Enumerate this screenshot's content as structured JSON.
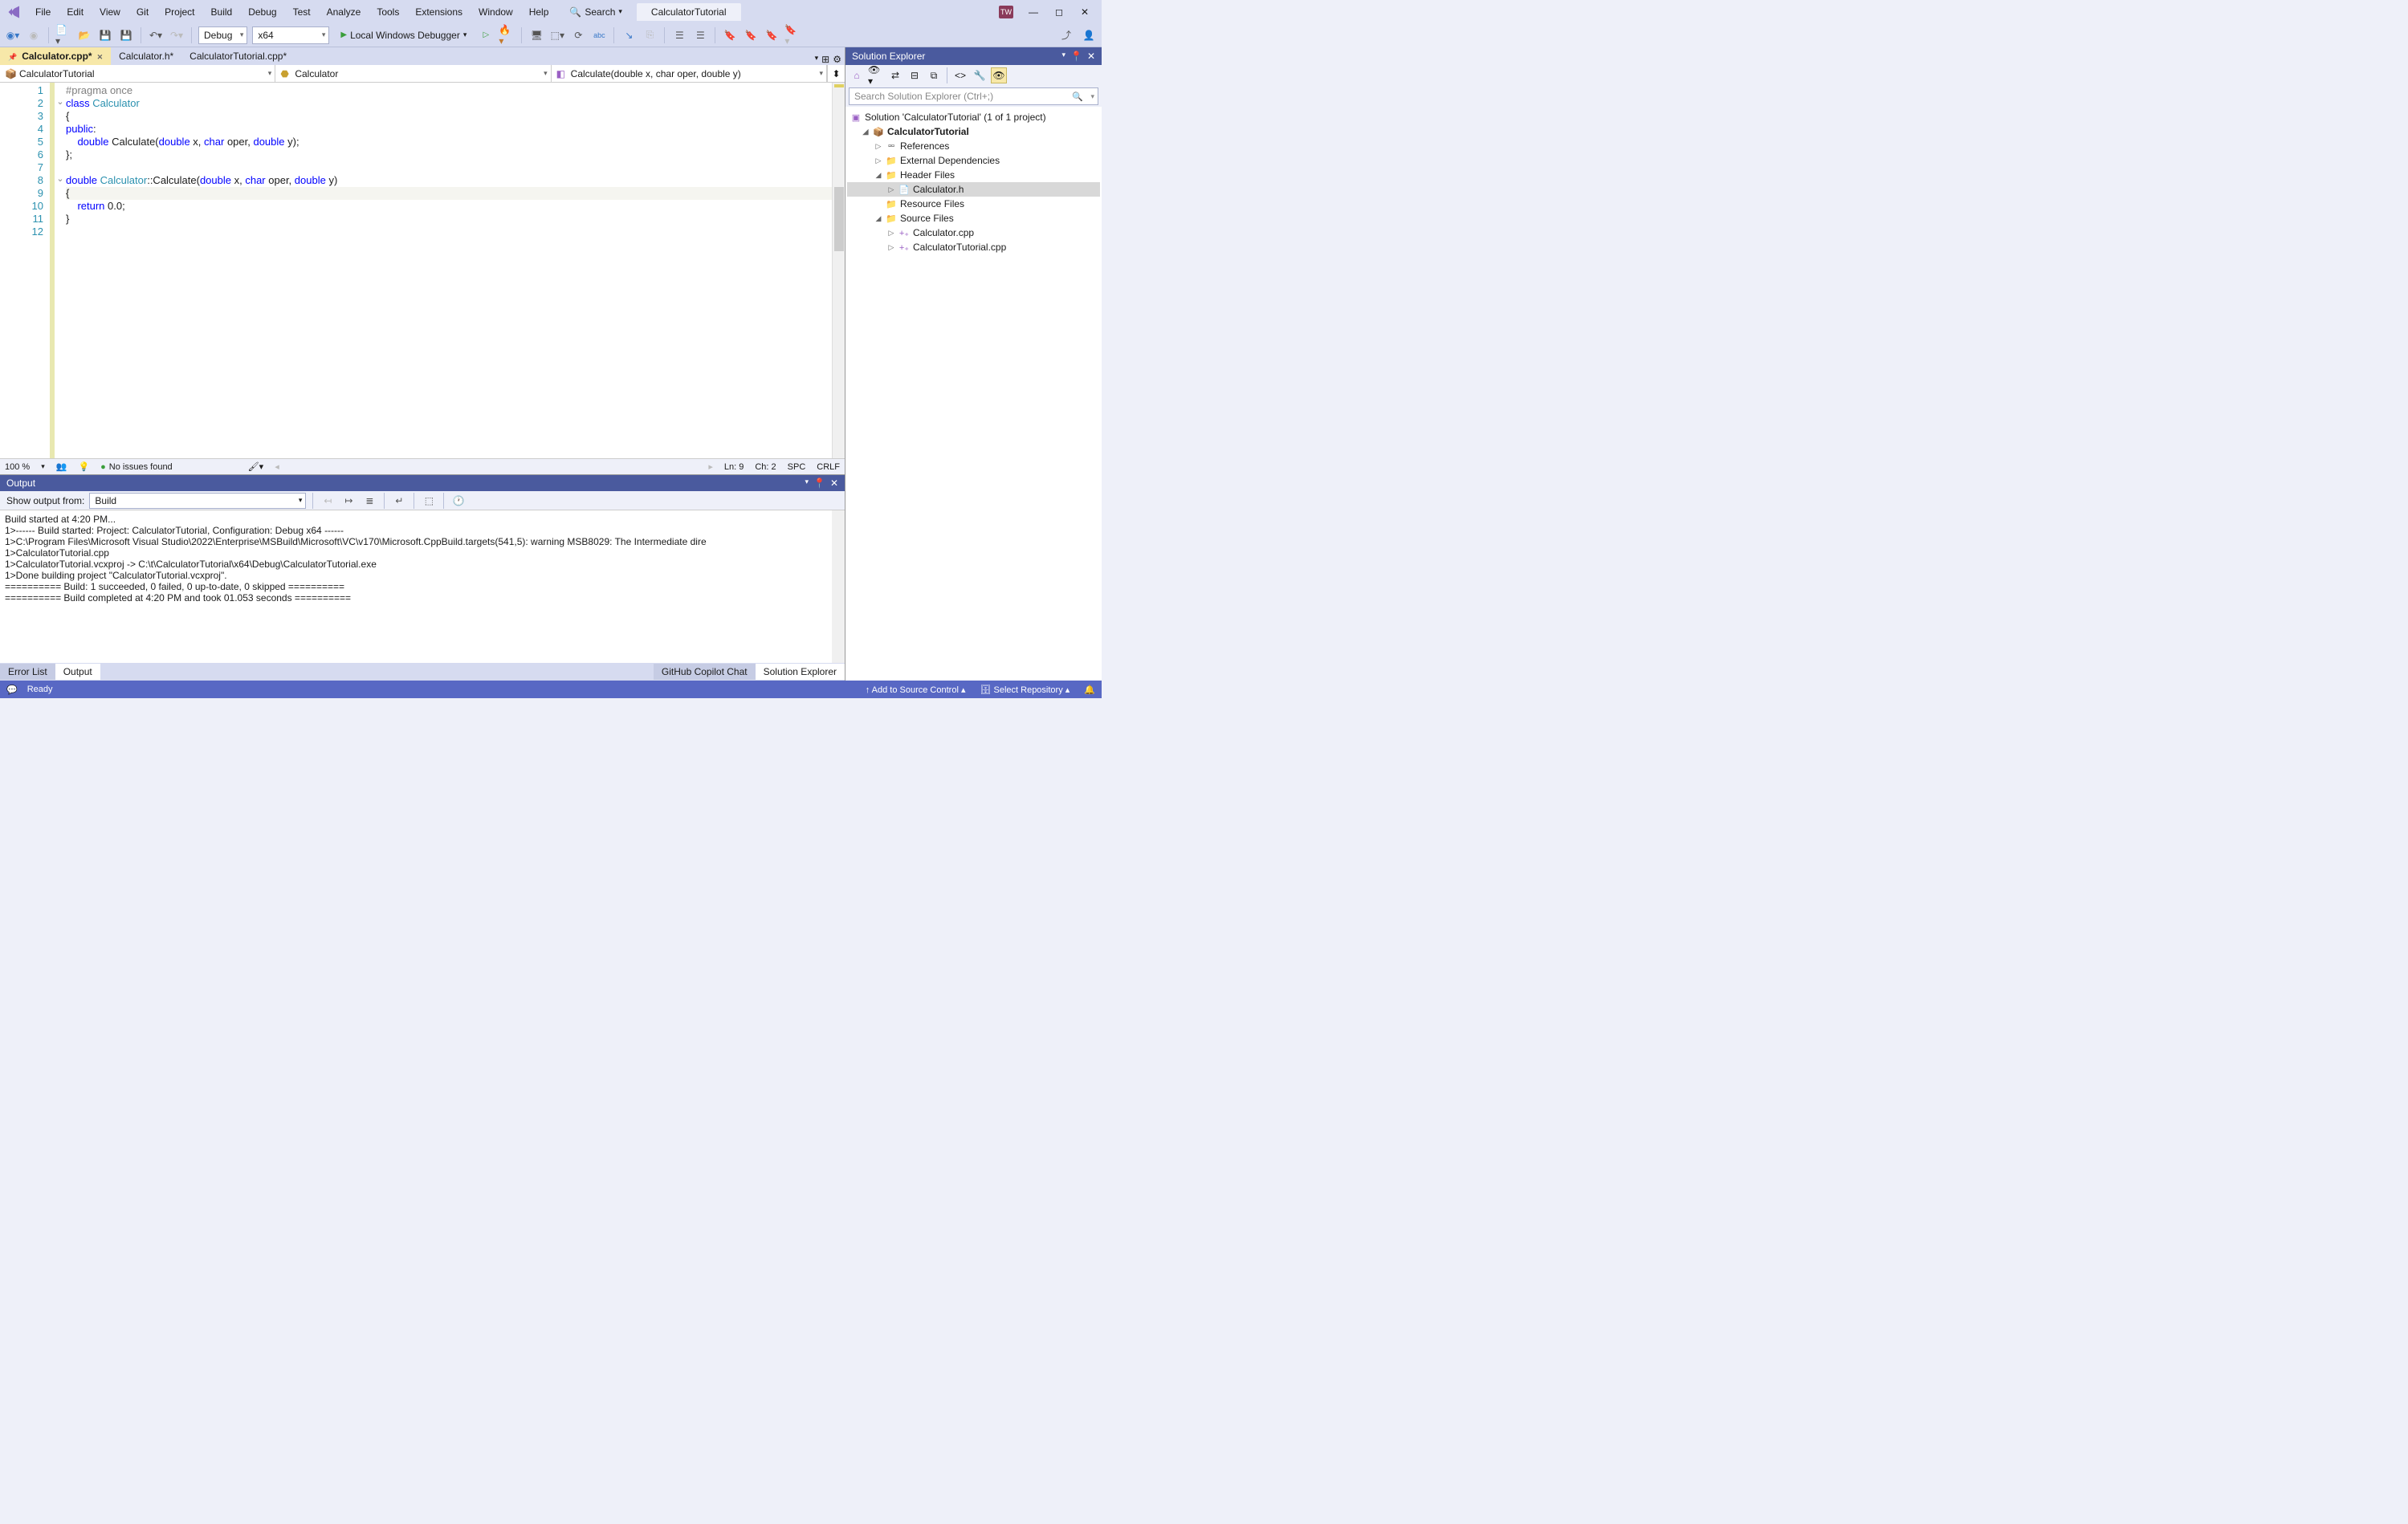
{
  "menu": [
    "File",
    "Edit",
    "View",
    "Git",
    "Project",
    "Build",
    "Debug",
    "Test",
    "Analyze",
    "Tools",
    "Extensions",
    "Window",
    "Help"
  ],
  "search_label": "Search",
  "title_tab": "CalculatorTutorial",
  "toolbar": {
    "config": "Debug",
    "platform": "x64",
    "debug_button": "Local Windows Debugger"
  },
  "doc_tabs": [
    {
      "name": "Calculator.cpp*",
      "active": true
    },
    {
      "name": "Calculator.h*",
      "active": false
    },
    {
      "name": "CalculatorTutorial.cpp*",
      "active": false
    }
  ],
  "nav": {
    "scope": "CalculatorTutorial",
    "class": "Calculator",
    "member": "Calculate(double x, char oper, double y)"
  },
  "code_lines": [
    {
      "n": 1,
      "outline": "",
      "html": "<span class='pp'>#pragma</span> <span class='pp'>once</span>"
    },
    {
      "n": 2,
      "outline": "⌄",
      "html": "<span class='kw'>class</span> <span class='typ'>Calculator</span>"
    },
    {
      "n": 3,
      "outline": "",
      "html": "{"
    },
    {
      "n": 4,
      "outline": "",
      "html": "<span class='kw'>public</span>:"
    },
    {
      "n": 5,
      "outline": "",
      "html": "    <span class='kw'>double</span> Calculate(<span class='kw'>double</span> x, <span class='kw'>char</span> oper, <span class='kw'>double</span> y);"
    },
    {
      "n": 6,
      "outline": "",
      "html": "};"
    },
    {
      "n": 7,
      "outline": "",
      "html": ""
    },
    {
      "n": 8,
      "outline": "⌄",
      "html": "<span class='kw'>double</span> <span class='typ'>Calculator</span>::Calculate(<span class='kw'>double</span> x, <span class='kw'>char</span> oper, <span class='kw'>double</span> y)"
    },
    {
      "n": 9,
      "outline": "",
      "html": "{",
      "cursor": true
    },
    {
      "n": 10,
      "outline": "",
      "html": "    <span class='kw'>return</span> 0.0;"
    },
    {
      "n": 11,
      "outline": "",
      "html": "}"
    },
    {
      "n": 12,
      "outline": "",
      "html": ""
    }
  ],
  "editor_status": {
    "zoom": "100 %",
    "issues": "No issues found",
    "ln": "Ln: 9",
    "ch": "Ch: 2",
    "spc": "SPC",
    "crlf": "CRLF"
  },
  "output": {
    "title": "Output",
    "show_from_label": "Show output from:",
    "source": "Build",
    "text": "Build started at 4:20 PM...\n1>------ Build started: Project: CalculatorTutorial, Configuration: Debug x64 ------\n1>C:\\Program Files\\Microsoft Visual Studio\\2022\\Enterprise\\MSBuild\\Microsoft\\VC\\v170\\Microsoft.CppBuild.targets(541,5): warning MSB8029: The Intermediate dire\n1>CalculatorTutorial.cpp\n1>CalculatorTutorial.vcxproj -> C:\\t\\CalculatorTutorial\\x64\\Debug\\CalculatorTutorial.exe\n1>Done building project \"CalculatorTutorial.vcxproj\".\n========== Build: 1 succeeded, 0 failed, 0 up-to-date, 0 skipped ==========\n========== Build completed at 4:20 PM and took 01.053 seconds =========="
  },
  "bottom_tabs": {
    "left": [
      "Error List",
      "Output"
    ],
    "active": "Output",
    "right": [
      "GitHub Copilot Chat",
      "Solution Explorer"
    ],
    "right_active": "Solution Explorer"
  },
  "solution_explorer": {
    "title": "Solution Explorer",
    "search_placeholder": "Search Solution Explorer (Ctrl+;)",
    "root": "Solution 'CalculatorTutorial' (1 of 1 project)",
    "project": "CalculatorTutorial",
    "nodes": {
      "references": "References",
      "external": "External Dependencies",
      "header": "Header Files",
      "calc_h": "Calculator.h",
      "resource": "Resource Files",
      "source": "Source Files",
      "calc_cpp": "Calculator.cpp",
      "tut_cpp": "CalculatorTutorial.cpp"
    }
  },
  "statusbar": {
    "ready": "Ready",
    "add_source": "Add to Source Control",
    "select_repo": "Select Repository"
  }
}
